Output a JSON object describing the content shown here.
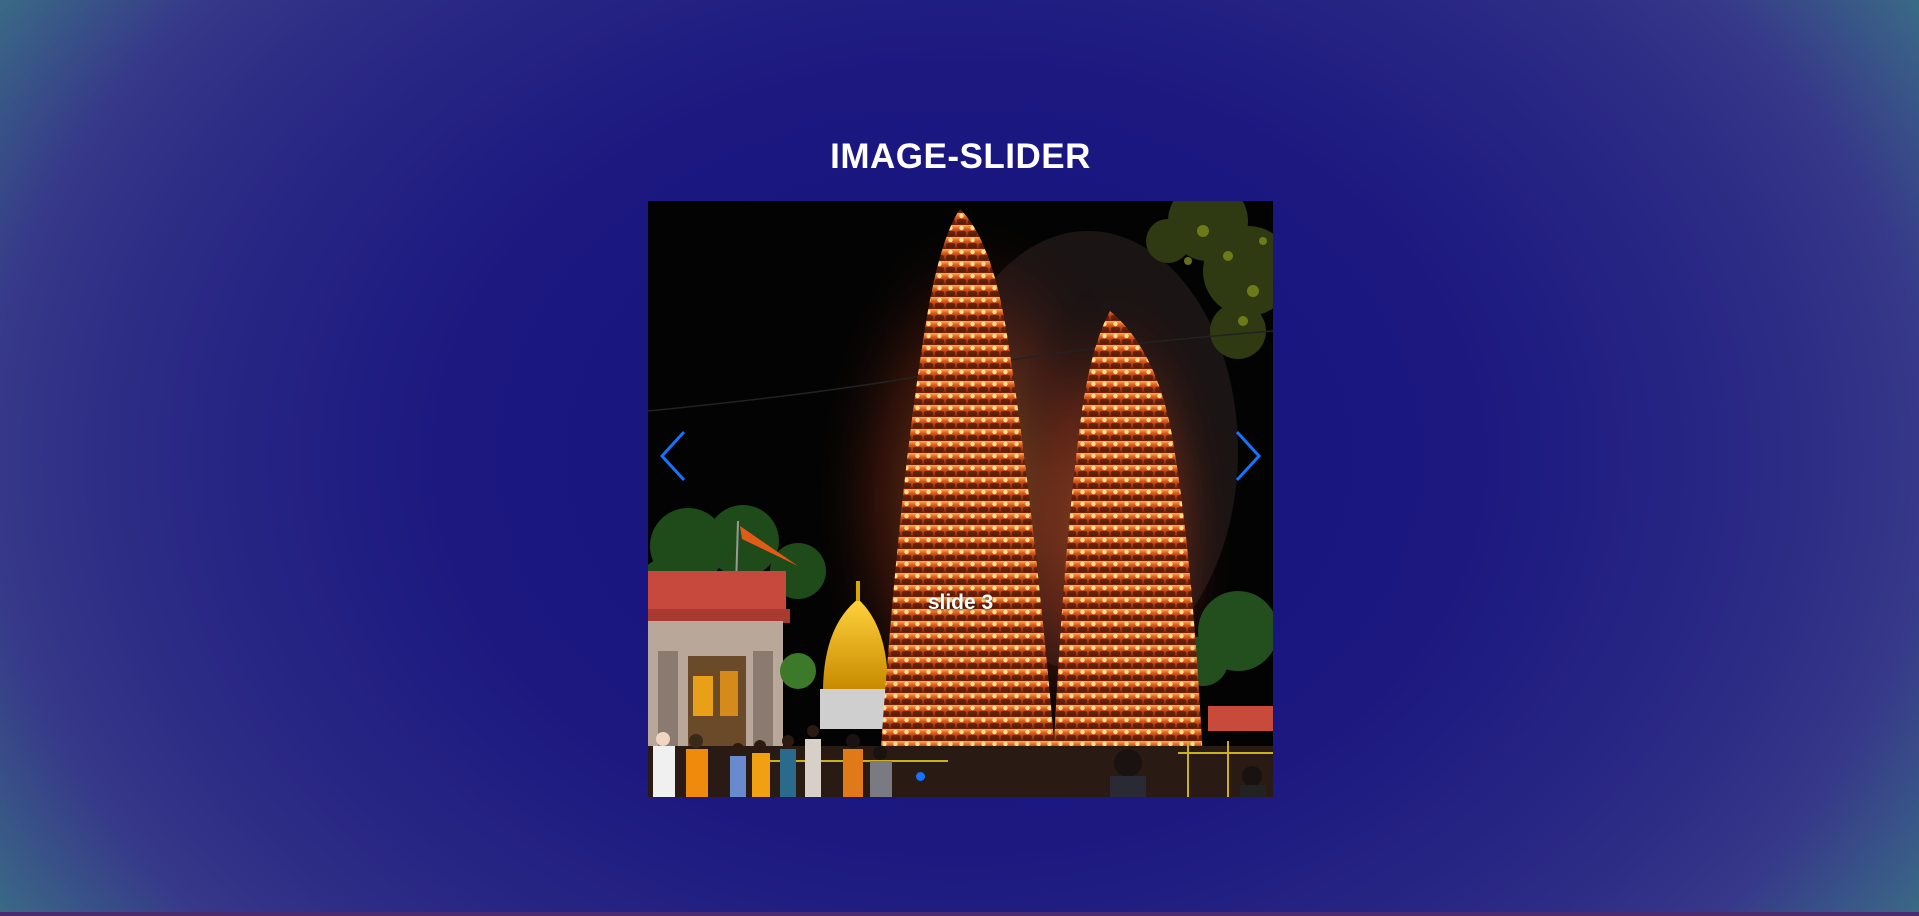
{
  "page": {
    "title": "IMAGE-SLIDER"
  },
  "slider": {
    "current_caption": "slide 3",
    "current_index": 3,
    "prev_icon": "chevron-left-icon",
    "next_icon": "chevron-right-icon",
    "accent_color": "#1673ff"
  },
  "colors": {
    "background_center": "#16127e",
    "background_edge": "#3b6f86",
    "title_text": "#ffffff"
  }
}
